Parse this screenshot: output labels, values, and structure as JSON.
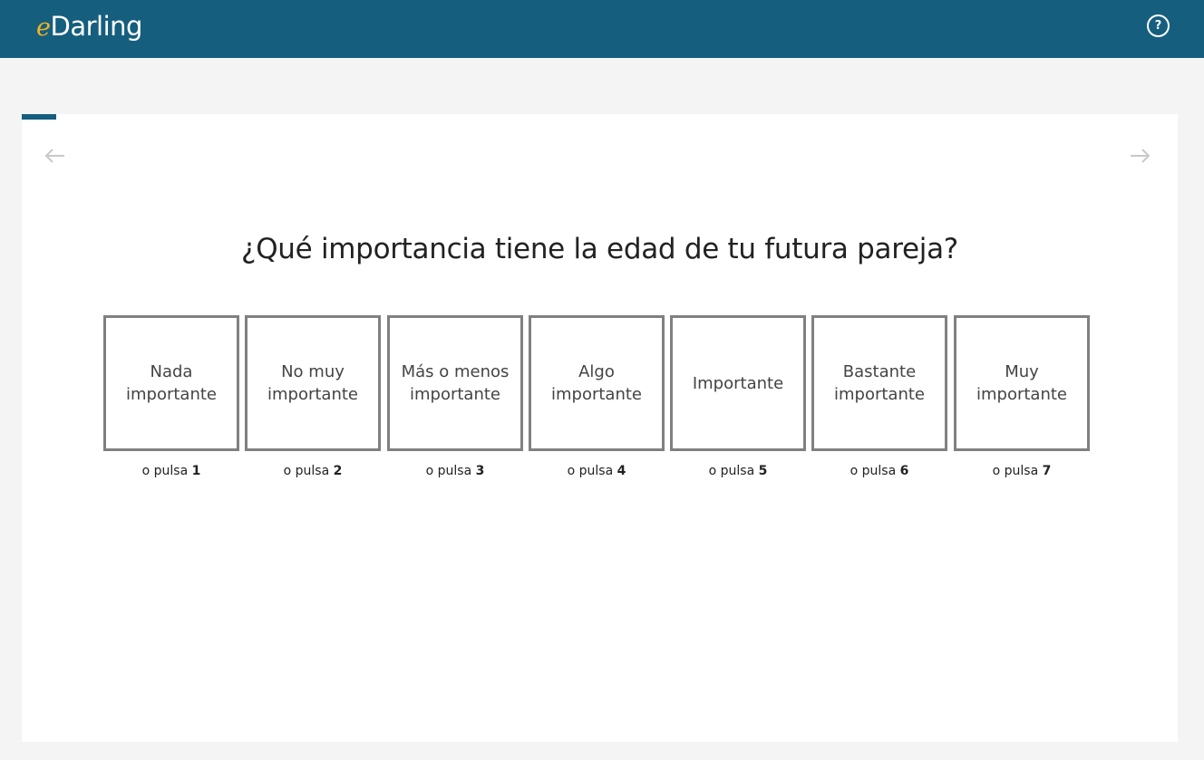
{
  "header": {
    "logo_prefix": "e",
    "logo_text": "Darling",
    "help_label": "?",
    "help_icon": "help-circle-icon",
    "background_color": "#165e7e",
    "logo_accent_color": "#f0b323"
  },
  "progress": {
    "fraction": 0.03
  },
  "nav": {
    "prev_icon": "arrow-left-icon",
    "next_icon": "arrow-right-icon"
  },
  "question": {
    "text": "¿Qué importancia tiene la edad de tu futura pareja?"
  },
  "options": [
    {
      "label": "Nada importante",
      "hint_prefix": "o pulsa",
      "key": "1"
    },
    {
      "label": "No muy importante",
      "hint_prefix": "o pulsa",
      "key": "2"
    },
    {
      "label": "Más o menos importante",
      "hint_prefix": "o pulsa",
      "key": "3"
    },
    {
      "label": "Algo importante",
      "hint_prefix": "o pulsa",
      "key": "4"
    },
    {
      "label": "Importante",
      "hint_prefix": "o pulsa",
      "key": "5"
    },
    {
      "label": "Bastante importante",
      "hint_prefix": "o pulsa",
      "key": "6"
    },
    {
      "label": "Muy importante",
      "hint_prefix": "o pulsa",
      "key": "7"
    }
  ]
}
